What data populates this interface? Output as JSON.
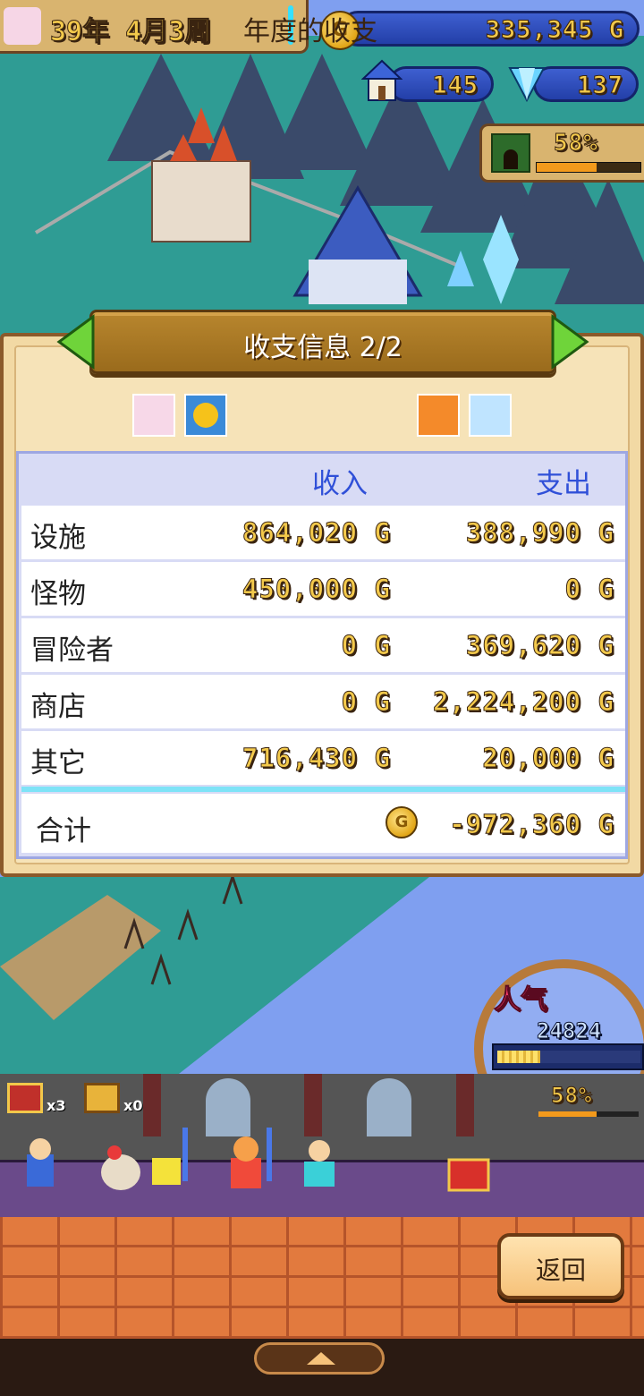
{
  "hud": {
    "date": "39年 4月3周",
    "gold": "335,345 G",
    "coin_symbol": "G",
    "houses": "145",
    "crystals": "137",
    "dungeon_progress": "58%"
  },
  "panel": {
    "title": "收支信息 2/2",
    "subtitle": "年度的收支",
    "columns": {
      "income": "收入",
      "expense": "支出"
    },
    "rows": [
      {
        "label": "设施",
        "income": "864,020 G",
        "expense": "388,990 G"
      },
      {
        "label": "怪物",
        "income": "450,000 G",
        "expense": "0 G"
      },
      {
        "label": "冒险者",
        "income": "0 G",
        "expense": "369,620 G"
      },
      {
        "label": "商店",
        "income": "0 G",
        "expense": "2,224,200 G"
      },
      {
        "label": "其它",
        "income": "716,430 G",
        "expense": "20,000 G"
      }
    ],
    "total": {
      "label": "合计",
      "value": "-972,360 G"
    }
  },
  "popularity": {
    "label": "人气",
    "value": "24824",
    "level": 0.3
  },
  "hall": {
    "red_chest_count": "x3",
    "gold_chest_count": "x0",
    "progress": "58%"
  },
  "buttons": {
    "back": "返回"
  },
  "colors": {
    "gold_text": "#f3c94b",
    "header_blue": "#3050d8",
    "panel_bg": "#f6e3b8",
    "table_bg": "#d8dbf5"
  },
  "icons": [
    "coin-icon",
    "house-icon",
    "crystal-icon",
    "dungeon-icon",
    "arrow-left-icon",
    "arrow-right-icon",
    "season-spring-icon",
    "season-summer-icon",
    "season-autumn-icon",
    "season-winter-icon",
    "chest-icon",
    "up-arrow-icon"
  ]
}
